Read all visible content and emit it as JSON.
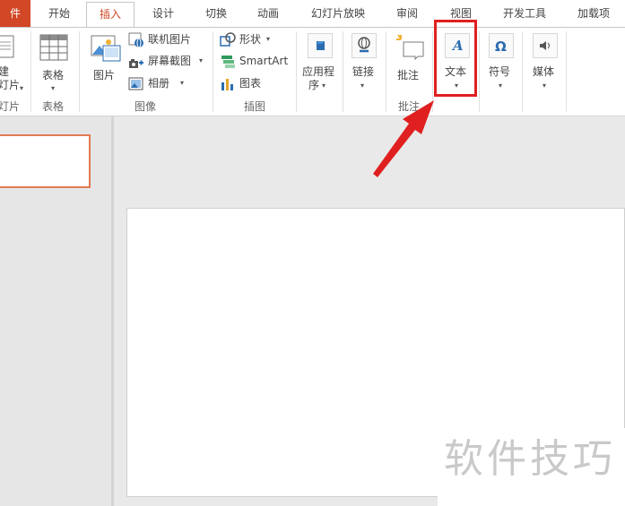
{
  "tabs": [
    {
      "label": "件"
    },
    {
      "label": "开始"
    },
    {
      "label": "插入"
    },
    {
      "label": "设计"
    },
    {
      "label": "切换"
    },
    {
      "label": "动画"
    },
    {
      "label": "幻灯片放映"
    },
    {
      "label": "审阅"
    },
    {
      "label": "视图"
    },
    {
      "label": "开发工具"
    },
    {
      "label": "加载项"
    }
  ],
  "active_tab": "插入",
  "ribbon": {
    "slides_group": {
      "new_slide_line1": "建",
      "new_slide_line2": "灯片",
      "group_label": "灯片"
    },
    "tables_group": {
      "table": "表格",
      "group_label": "表格"
    },
    "images_group": {
      "picture": "图片",
      "online_picture": "联机图片",
      "screenshot": "屏幕截图",
      "album": "相册",
      "group_label": "图像"
    },
    "illustrations_group": {
      "shapes": "形状",
      "smartart": "SmartArt",
      "chart": "图表",
      "group_label": "插图"
    },
    "apps_group": {
      "apps_line1": "应用程",
      "apps_line2": "序"
    },
    "links_group": {
      "link": "链接"
    },
    "comments_group": {
      "comment": "批注",
      "group_label": "批注"
    },
    "text_group": {
      "text": "文本"
    },
    "symbols_group": {
      "symbol": "符号"
    },
    "media_group": {
      "media": "媒体"
    }
  },
  "watermark": {
    "text": "软件技巧"
  },
  "colors": {
    "accent": "#d24726",
    "highlight_box": "#e02020",
    "thumbnail_border": "#e37a52",
    "icon_blue": "#2b6cb0"
  }
}
